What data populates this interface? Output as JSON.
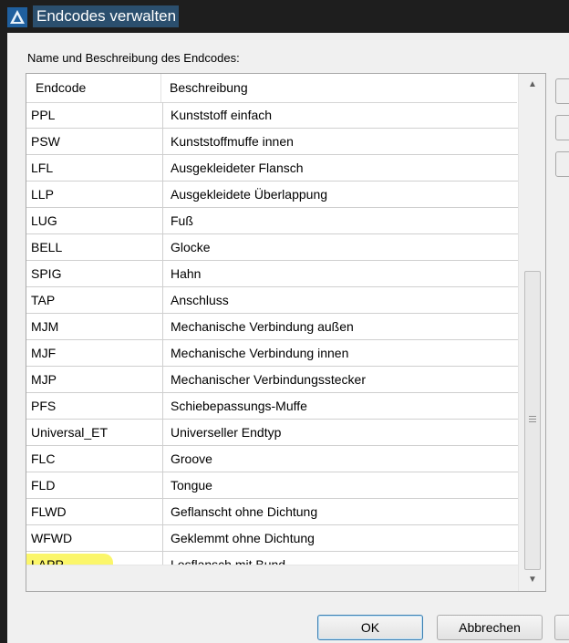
{
  "window": {
    "title": "Endcodes verwalten"
  },
  "caption": "Name und Beschreibung des Endcodes:",
  "columns": {
    "code": "Endcode",
    "description": "Beschreibung"
  },
  "rows": [
    {
      "code": "PPL",
      "description": "Kunststoff einfach"
    },
    {
      "code": "PSW",
      "description": "Kunststoffmuffe innen"
    },
    {
      "code": "LFL",
      "description": "Ausgekleideter Flansch"
    },
    {
      "code": "LLP",
      "description": "Ausgekleidete Überlappung"
    },
    {
      "code": "LUG",
      "description": "Fuß"
    },
    {
      "code": "BELL",
      "description": "Glocke"
    },
    {
      "code": "SPIG",
      "description": "Hahn"
    },
    {
      "code": "TAP",
      "description": "Anschluss"
    },
    {
      "code": "MJM",
      "description": "Mechanische Verbindung außen"
    },
    {
      "code": "MJF",
      "description": "Mechanische Verbindung innen"
    },
    {
      "code": "MJP",
      "description": "Mechanischer Verbindungsstecker"
    },
    {
      "code": "PFS",
      "description": "Schiebepassungs-Muffe"
    },
    {
      "code": "Universal_ET",
      "description": "Universeller Endtyp"
    },
    {
      "code": "FLC",
      "description": "Groove"
    },
    {
      "code": "FLD",
      "description": "Tongue"
    },
    {
      "code": "FLWD",
      "description": "Geflanscht ohne Dichtung"
    },
    {
      "code": "WFWD",
      "description": "Geklemmt ohne Dichtung"
    },
    {
      "code": "LAPP",
      "description": "Losflansch mit Bund"
    }
  ],
  "highlight": {
    "row_code": "LAPP",
    "color": "#fbf55a"
  },
  "buttons": {
    "ok": "OK",
    "cancel": "Abbrechen"
  },
  "icons": {
    "app": "autocad-icon",
    "scroll_up": "arrow-up-icon",
    "scroll_down": "arrow-down-icon",
    "grip": "grip-icon"
  },
  "colors": {
    "titlebar": "#1e1e1e",
    "title_bg": "#2b4f6e",
    "dialog_bg": "#f0f0f0",
    "accent_ok_border": "#3c7fb1"
  }
}
